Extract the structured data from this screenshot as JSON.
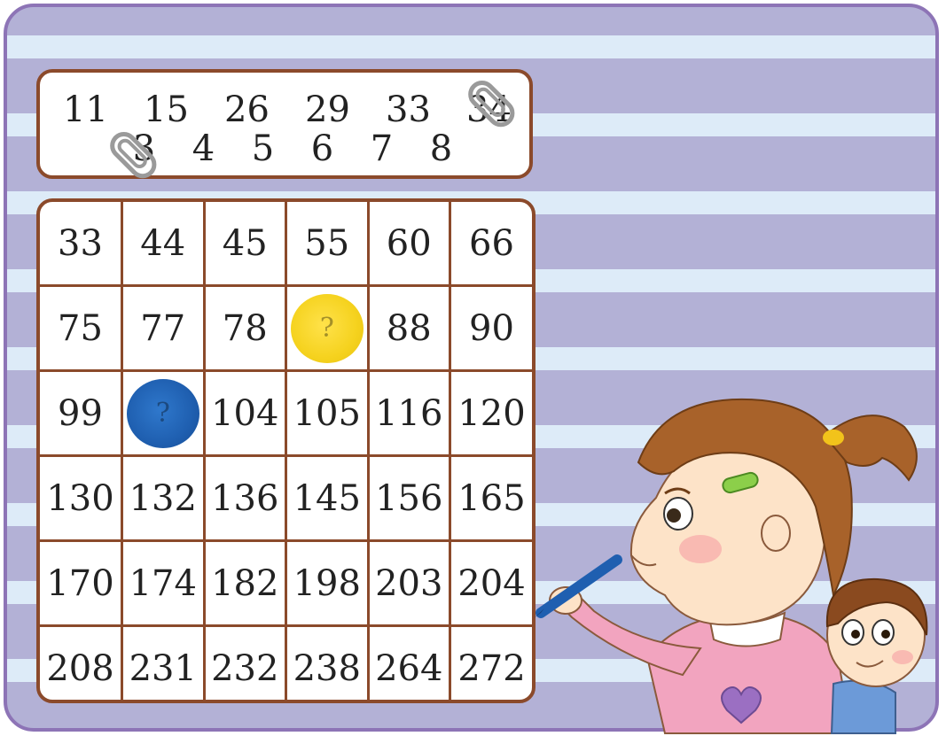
{
  "title_numbers": {
    "row1": [
      "11",
      "15",
      "26",
      "29",
      "33",
      "34"
    ],
    "row2": [
      "3",
      "4",
      "5",
      "6",
      "7",
      "8"
    ]
  },
  "grid": [
    [
      "33",
      "44",
      "45",
      "55",
      "60",
      "66"
    ],
    [
      "75",
      "77",
      "78",
      "",
      "88",
      "90"
    ],
    [
      "99",
      "",
      "104",
      "105",
      "116",
      "120"
    ],
    [
      "130",
      "132",
      "136",
      "145",
      "156",
      "165"
    ],
    [
      "170",
      "174",
      "182",
      "198",
      "203",
      "204"
    ],
    [
      "208",
      "231",
      "232",
      "238",
      "264",
      "272"
    ]
  ],
  "colors": {
    "card_border": "#8b4a2b",
    "frame_border": "#8d74b6",
    "yellow_mark": "#f5d21e",
    "blue_mark": "#1f5fb0"
  }
}
